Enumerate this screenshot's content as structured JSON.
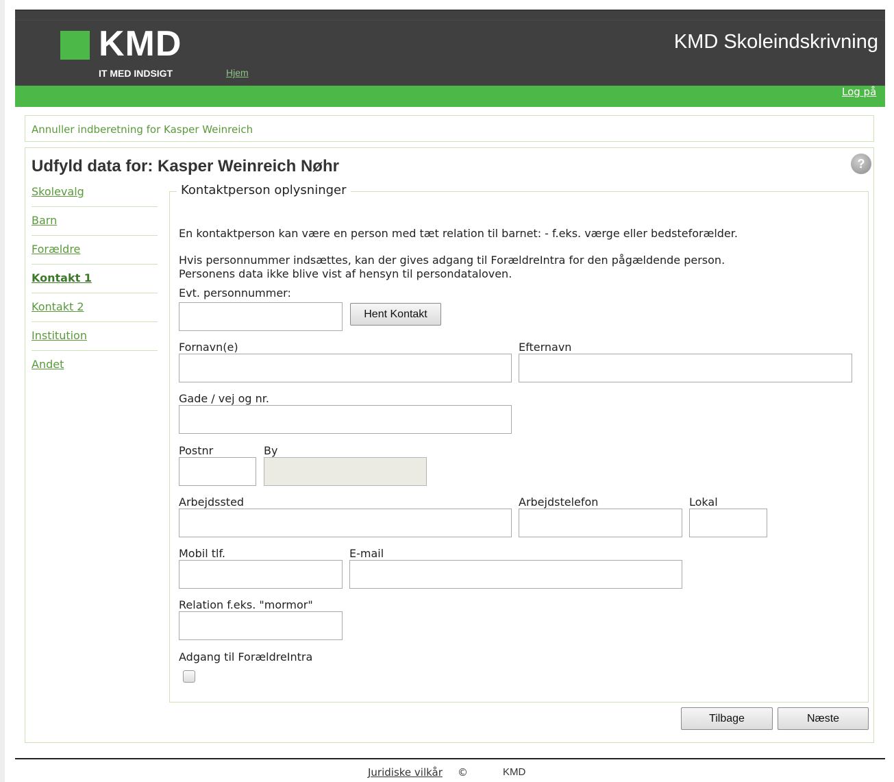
{
  "header": {
    "logo_text": "KMD",
    "logo_tagline": "IT MED INDSIGT",
    "home_link": "Hjem",
    "app_title": "KMD Skoleindskrivning",
    "login_link": "Log på"
  },
  "cancel_link": "Annuller indberetning for Kasper Weinreich",
  "page_title": "Udfyld data for: Kasper Weinreich Nøhr",
  "help_icon": "?",
  "sidebar": {
    "items": [
      {
        "label": "Skolevalg"
      },
      {
        "label": "Barn"
      },
      {
        "label": "Forældre"
      },
      {
        "label": "Kontakt 1"
      },
      {
        "label": "Kontakt 2"
      },
      {
        "label": "Institution"
      },
      {
        "label": "Andet"
      }
    ]
  },
  "form": {
    "legend": "Kontaktperson oplysninger",
    "intro": "En kontaktperson kan være en person med tæt relation til barnet: - f.eks. værge eller bedsteforælder.",
    "info_line1": "Hvis personnummer indsættes, kan der gives adgang til ForældreIntra for den pågældende person.",
    "info_line2": "Personens data ikke blive vist af hensyn til persondataloven.",
    "cpr_label": "Evt. personnummer:",
    "cpr_value": "",
    "fetch_button": "Hent Kontakt",
    "firstname_label": "Fornavn(e)",
    "firstname_value": "",
    "lastname_label": "Efternavn",
    "lastname_value": "",
    "street_label": "Gade / vej og nr.",
    "street_value": "",
    "zip_label": "Postnr",
    "zip_value": "",
    "city_label": "By",
    "city_value": "",
    "workplace_label": "Arbejdssted",
    "workplace_value": "",
    "workphone_label": "Arbejdstelefon",
    "workphone_value": "",
    "ext_label": "Lokal",
    "ext_value": "",
    "mobile_label": "Mobil tlf.",
    "mobile_value": "",
    "email_label": "E-mail",
    "email_value": "",
    "relation_label": "Relation f.eks. \"mormor\"",
    "relation_value": "",
    "access_label": "Adgang til ForældreIntra",
    "access_checked": false
  },
  "buttons": {
    "back": "Tilbage",
    "next": "Næste"
  },
  "footer": {
    "terms_link": "Juridiske vilkår",
    "copyright": "©",
    "company": "KMD"
  },
  "colors": {
    "brand_green": "#4cb848",
    "header_bg": "#404040",
    "link_green": "#5a9a3a",
    "border_green": "#cfe3b8"
  }
}
